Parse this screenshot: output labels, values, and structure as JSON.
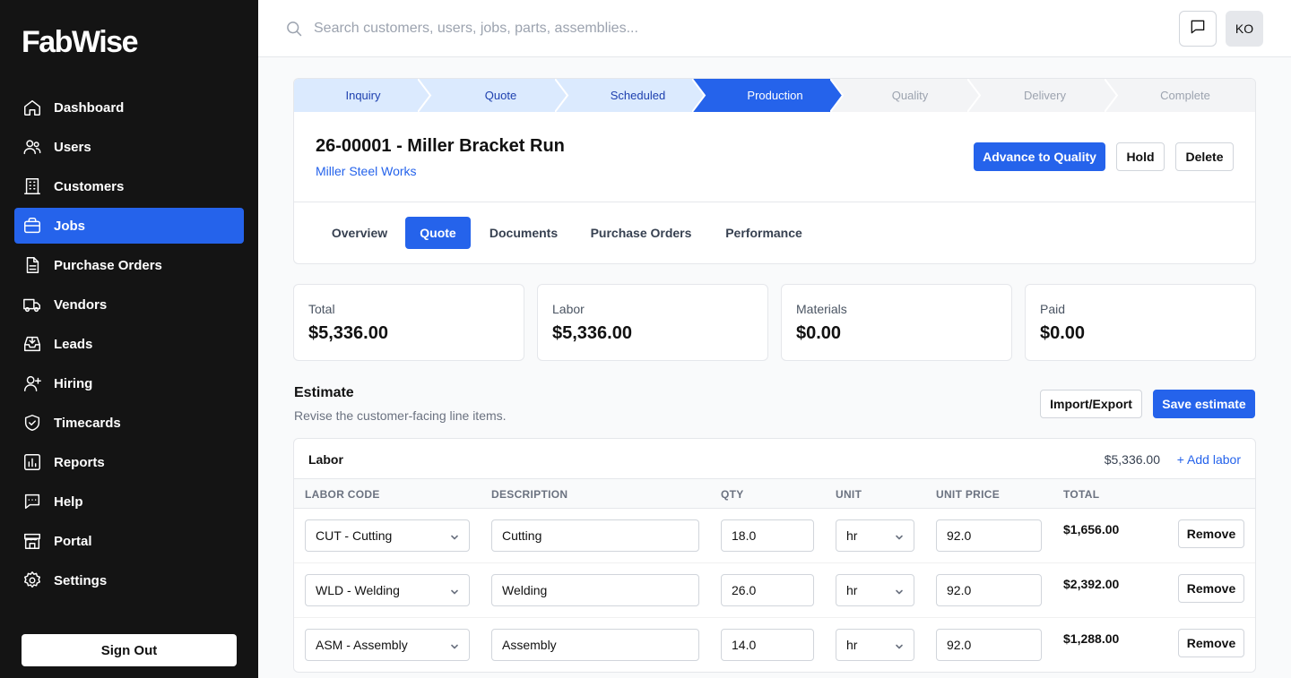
{
  "app": {
    "logo": "FabWise"
  },
  "sidebar": {
    "items": [
      {
        "label": "Dashboard",
        "icon": "home-icon"
      },
      {
        "label": "Users",
        "icon": "users-icon"
      },
      {
        "label": "Customers",
        "icon": "building-icon"
      },
      {
        "label": "Jobs",
        "icon": "briefcase-icon",
        "active": true
      },
      {
        "label": "Purchase Orders",
        "icon": "document-icon"
      },
      {
        "label": "Vendors",
        "icon": "truck-icon"
      },
      {
        "label": "Leads",
        "icon": "inbox-icon"
      },
      {
        "label": "Hiring",
        "icon": "user-plus-icon"
      },
      {
        "label": "Timecards",
        "icon": "shield-check-icon"
      },
      {
        "label": "Reports",
        "icon": "chart-icon"
      },
      {
        "label": "Help",
        "icon": "chat-icon"
      },
      {
        "label": "Portal",
        "icon": "storefront-icon"
      },
      {
        "label": "Settings",
        "icon": "gear-icon"
      }
    ],
    "sign_out": "Sign Out"
  },
  "topbar": {
    "search_placeholder": "Search customers, users, jobs, parts, assemblies...",
    "avatar_initials": "KO"
  },
  "stepper": {
    "steps": [
      {
        "label": "Inquiry",
        "state": "done"
      },
      {
        "label": "Quote",
        "state": "done"
      },
      {
        "label": "Scheduled",
        "state": "done"
      },
      {
        "label": "Production",
        "state": "current"
      },
      {
        "label": "Quality",
        "state": "todo"
      },
      {
        "label": "Delivery",
        "state": "todo"
      },
      {
        "label": "Complete",
        "state": "todo"
      }
    ]
  },
  "job": {
    "title": "26-00001 - Miller Bracket Run",
    "customer": "Miller Steel Works",
    "actions": {
      "advance": "Advance to Quality",
      "hold": "Hold",
      "delete": "Delete"
    }
  },
  "tabs": [
    {
      "label": "Overview"
    },
    {
      "label": "Quote",
      "active": true
    },
    {
      "label": "Documents"
    },
    {
      "label": "Purchase Orders"
    },
    {
      "label": "Performance"
    }
  ],
  "stats": [
    {
      "label": "Total",
      "value": "$5,336.00"
    },
    {
      "label": "Labor",
      "value": "$5,336.00"
    },
    {
      "label": "Materials",
      "value": "$0.00"
    },
    {
      "label": "Paid",
      "value": "$0.00"
    }
  ],
  "estimate": {
    "title": "Estimate",
    "subtitle": "Revise the customer-facing line items.",
    "import_export": "Import/Export",
    "save": "Save estimate"
  },
  "labor": {
    "title": "Labor",
    "total": "$5,336.00",
    "add": "+ Add labor",
    "columns": [
      "LABOR CODE",
      "DESCRIPTION",
      "QTY",
      "UNIT",
      "UNIT PRICE",
      "TOTAL"
    ],
    "rows": [
      {
        "code": "CUT - Cutting",
        "description": "Cutting",
        "qty": "18.0",
        "unit": "hr",
        "unit_price": "92.0",
        "total": "$1,656.00",
        "remove": "Remove"
      },
      {
        "code": "WLD - Welding",
        "description": "Welding",
        "qty": "26.0",
        "unit": "hr",
        "unit_price": "92.0",
        "total": "$2,392.00",
        "remove": "Remove"
      },
      {
        "code": "ASM - Assembly",
        "description": "Assembly",
        "qty": "14.0",
        "unit": "hr",
        "unit_price": "92.0",
        "total": "$1,288.00",
        "remove": "Remove"
      }
    ]
  }
}
